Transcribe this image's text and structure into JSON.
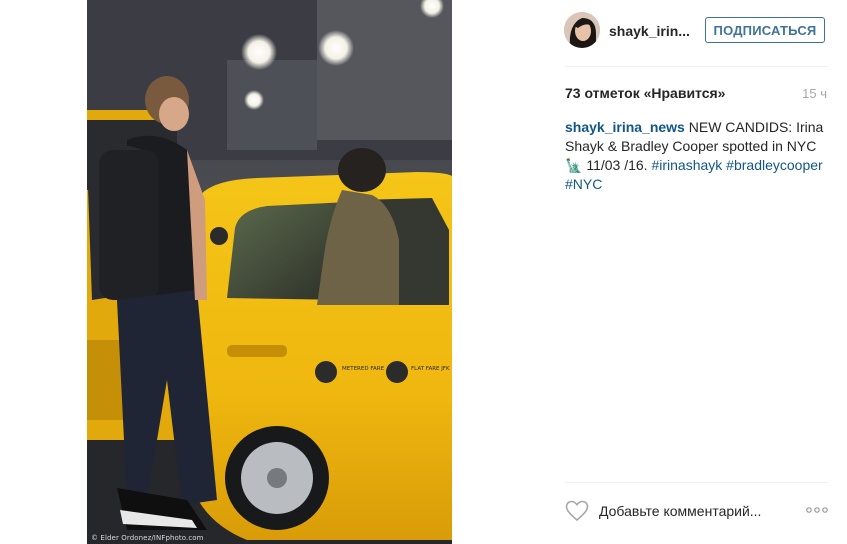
{
  "header": {
    "username": "shayk_irin...",
    "follow_label": "ПОДПИСАТЬСЯ"
  },
  "post": {
    "likes": "73 отметок «Нравится»",
    "time": "15 ч",
    "caption_user": "shayk_irina_news",
    "caption_text": " NEW CANDIDS: Irina Shayk & Bradley Cooper spotted in NYC 🗽 11/03 /16. ",
    "hashtags": [
      "#irinashayk",
      "#bradleycooper",
      "#NYC"
    ]
  },
  "photo": {
    "credit": "© Elder Ordonez/INFphoto.com",
    "taxi_text_1": "METERED FARE",
    "taxi_text_2": "FLAT FARE JFK",
    "description_icon": "taxi-photo"
  },
  "actions": {
    "like_icon": "heart-outline-icon",
    "comment_placeholder": "Добавьте комментарий...",
    "more_icon": "more-options-icon"
  },
  "colors": {
    "link": "#125688",
    "button": "#3f729b",
    "text": "#262626",
    "muted": "#a5a7aa"
  }
}
